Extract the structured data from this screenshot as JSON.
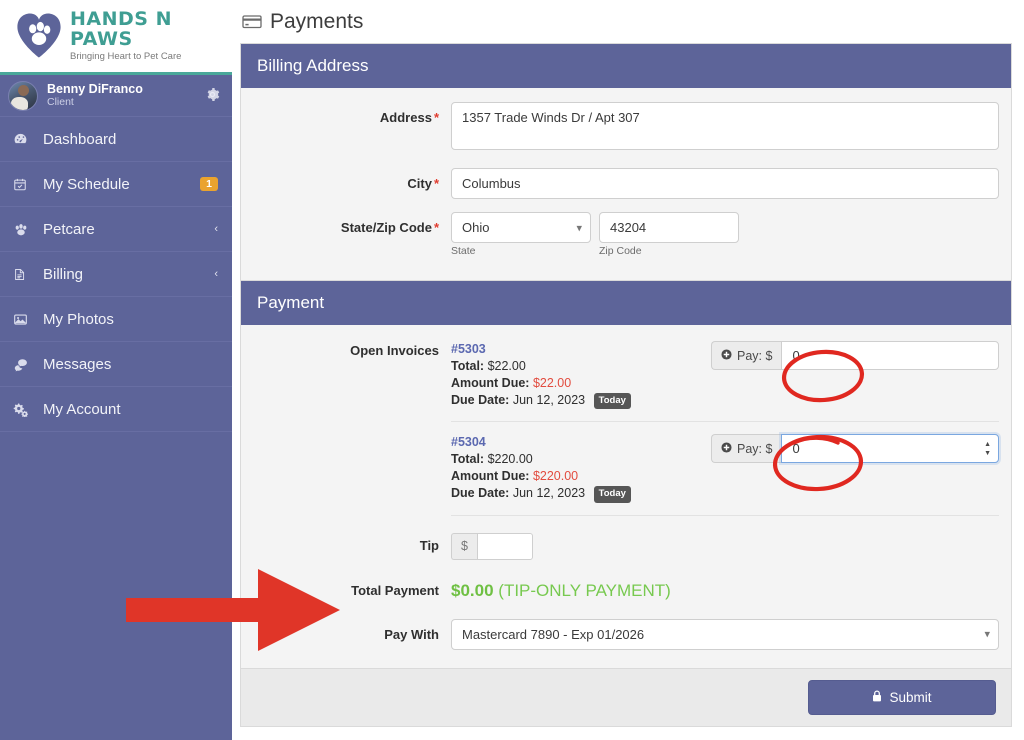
{
  "brand": {
    "name": "HANDS N PAWS",
    "tagline": "Bringing Heart to Pet Care",
    "accent_teal": "#3f9e93",
    "sidebar_bg": "#5d6499"
  },
  "profile": {
    "name": "Benny DiFranco",
    "role": "Client",
    "gear_icon": "gear-icon",
    "avatar_icon": "avatar"
  },
  "sidebar": {
    "items": [
      {
        "label": "Dashboard",
        "icon": "dashboard-icon",
        "badge": "",
        "caret": ""
      },
      {
        "label": "My Schedule",
        "icon": "calendar-icon",
        "badge": "1",
        "caret": ""
      },
      {
        "label": "Petcare",
        "icon": "paw-icon",
        "badge": "",
        "caret": "‹"
      },
      {
        "label": "Billing",
        "icon": "document-icon",
        "badge": "",
        "caret": "‹"
      },
      {
        "label": "My Photos",
        "icon": "photo-icon",
        "badge": "",
        "caret": ""
      },
      {
        "label": "Messages",
        "icon": "chat-icon",
        "badge": "",
        "caret": ""
      },
      {
        "label": "My Account",
        "icon": "cogs-icon",
        "badge": "",
        "caret": ""
      }
    ]
  },
  "header": {
    "title": "Payments",
    "icon": "credit-card-icon"
  },
  "billing_address": {
    "section_title": "Billing Address",
    "address_label": "Address",
    "address_value": "1357 Trade Winds Dr / Apt 307",
    "city_label": "City",
    "city_value": "Columbus",
    "state_zip_label": "State/Zip Code",
    "state_value": "Ohio",
    "state_hint": "State",
    "zip_value": "43204",
    "zip_hint": "Zip Code",
    "required_marker": "*"
  },
  "payment": {
    "section_title": "Payment",
    "open_invoices_label": "Open Invoices",
    "invoices": [
      {
        "number": "#5303",
        "total_label": "Total:",
        "total_value": "$22.00",
        "due_label": "Amount Due:",
        "due_value": "$22.00",
        "date_label": "Due Date:",
        "date_value": "Jun 12, 2023",
        "badge": "Today",
        "pay_label": "Pay: $",
        "pay_value": "0",
        "focused": false
      },
      {
        "number": "#5304",
        "total_label": "Total:",
        "total_value": "$220.00",
        "due_label": "Amount Due:",
        "due_value": "$220.00",
        "date_label": "Due Date:",
        "date_value": "Jun 12, 2023",
        "badge": "Today",
        "pay_label": "Pay: $",
        "pay_value": "0",
        "focused": true
      }
    ],
    "tip_label": "Tip",
    "tip_prefix": "$",
    "tip_value": "",
    "total_label": "Total Payment",
    "total_amount": "$0.00",
    "total_note": "(TIP-ONLY PAYMENT)",
    "total_color": "#6fc043",
    "pay_with_label": "Pay With",
    "pay_with_value": "Mastercard 7890 - Exp 01/2026",
    "submit_label": "Submit",
    "submit_icon": "lock-icon"
  },
  "annotations": {
    "arrow_color": "#e03528",
    "circle_color": "#e02820",
    "arrow_name": "red-arrow-pointing-at-total-payment",
    "circle_1_name": "red-circle-on-invoice-5303-pay-amount",
    "circle_2_name": "red-circle-on-invoice-5304-pay-amount"
  }
}
